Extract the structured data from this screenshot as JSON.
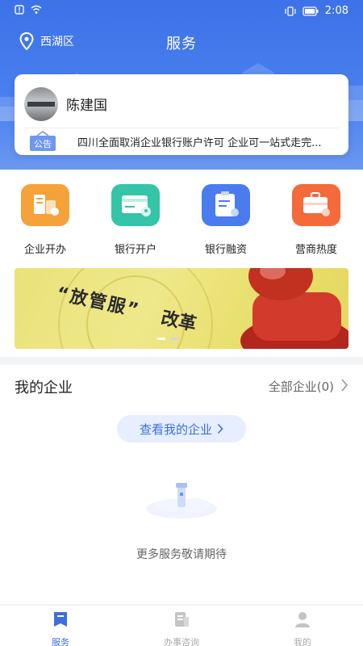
{
  "status_bar": {
    "time": "2:08"
  },
  "header": {
    "location": "西湖区",
    "title": "服务"
  },
  "user_card": {
    "name": "陈建国",
    "notice_badge": "公告",
    "notice_text": "四川全面取消企业银行账户许可 企业可一站式走完..."
  },
  "services": [
    {
      "label": "企业开办",
      "color": "#f5a23a",
      "icon": "building-icon"
    },
    {
      "label": "银行开户",
      "color": "#34c4a8",
      "icon": "bank-card-icon"
    },
    {
      "label": "银行融资",
      "color": "#4a7cf0",
      "icon": "clipboard-icon"
    },
    {
      "label": "营商热度",
      "color": "#f46a3a",
      "icon": "toolbox-icon"
    }
  ],
  "banner": {
    "line1": "“放管服”",
    "line2": "改革"
  },
  "enterprise": {
    "title": "我的企业",
    "all_link": "全部企业(0)",
    "view_button": "查看我的企业",
    "empty_text": "更多服务敬请期待"
  },
  "tabs": [
    {
      "label": "服务",
      "active": true
    },
    {
      "label": "办事咨询",
      "active": false
    },
    {
      "label": "我的",
      "active": false
    }
  ],
  "colors": {
    "primary": "#3d6fe0",
    "header": "#4a80ee"
  }
}
